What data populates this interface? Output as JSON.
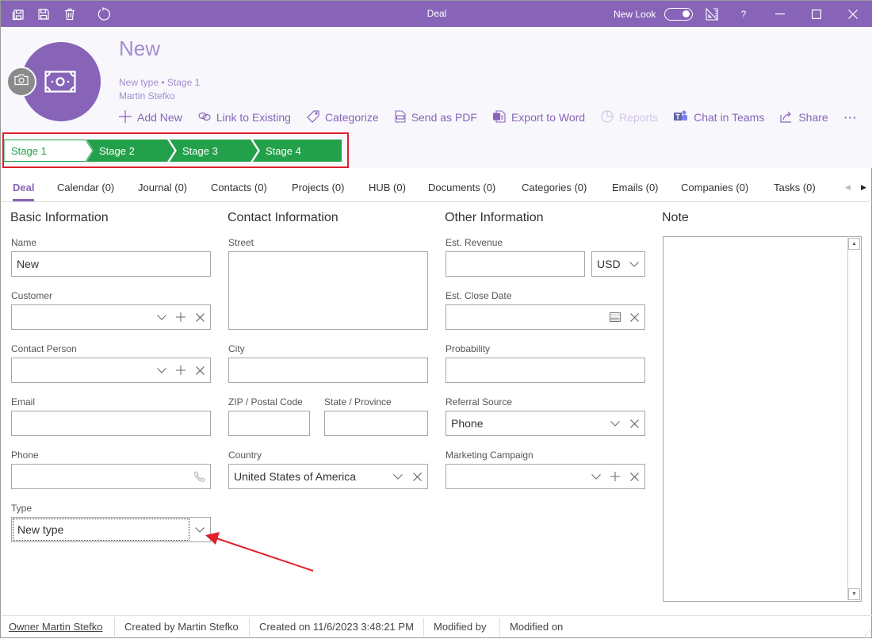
{
  "window": {
    "title": "Deal",
    "new_look_label": "New Look",
    "new_look_on": true,
    "help_label": "?"
  },
  "titlebar_icons": [
    "save-and-close-icon",
    "save-icon",
    "delete-icon",
    "refresh-icon"
  ],
  "record": {
    "title": "New",
    "subtitle": "New type • Stage 1",
    "owner": "Martin Stefko"
  },
  "actions": [
    {
      "label": "Add New",
      "icon": "plus-icon",
      "enabled": true
    },
    {
      "label": "Link to Existing",
      "icon": "link-icon",
      "enabled": true
    },
    {
      "label": "Categorize",
      "icon": "tag-icon",
      "enabled": true
    },
    {
      "label": "Send as PDF",
      "icon": "pdf-icon",
      "enabled": true
    },
    {
      "label": "Export to Word",
      "icon": "word-icon",
      "enabled": true
    },
    {
      "label": "Reports",
      "icon": "pie-chart-icon",
      "enabled": false
    },
    {
      "label": "Chat in Teams",
      "icon": "teams-icon",
      "enabled": true
    },
    {
      "label": "Share",
      "icon": "share-icon",
      "enabled": true
    }
  ],
  "stages": [
    {
      "label": "Stage 1",
      "current": true
    },
    {
      "label": "Stage 2",
      "current": false
    },
    {
      "label": "Stage 3",
      "current": false
    },
    {
      "label": "Stage 4",
      "current": false
    }
  ],
  "colors": {
    "brand": "#8764b8",
    "stage_green": "#23a04a",
    "highlight_red": "#e0202a"
  },
  "tabs": [
    {
      "label": "Deal",
      "active": true
    },
    {
      "label": "Calendar (0)"
    },
    {
      "label": "Journal (0)"
    },
    {
      "label": "Contacts (0)"
    },
    {
      "label": "Projects (0)"
    },
    {
      "label": "HUB (0)"
    },
    {
      "label": "Documents (0)"
    },
    {
      "label": "Categories (0)"
    },
    {
      "label": "Emails (0)"
    },
    {
      "label": "Companies (0)"
    },
    {
      "label": "Tasks (0)"
    }
  ],
  "sections": {
    "basic": {
      "title": "Basic Information",
      "name_label": "Name",
      "name_value": "New",
      "customer_label": "Customer",
      "customer_value": "",
      "contact_person_label": "Contact Person",
      "contact_person_value": "",
      "email_label": "Email",
      "email_value": "",
      "phone_label": "Phone",
      "phone_value": "",
      "type_label": "Type",
      "type_value": "New type"
    },
    "contact": {
      "title": "Contact Information",
      "street_label": "Street",
      "street_value": "",
      "city_label": "City",
      "city_value": "",
      "zip_label": "ZIP / Postal Code",
      "zip_value": "",
      "state_label": "State / Province",
      "state_value": "",
      "country_label": "Country",
      "country_value": "United States of America"
    },
    "other": {
      "title": "Other Information",
      "revenue_label": "Est. Revenue",
      "revenue_value": "",
      "currency_value": "USD",
      "close_date_label": "Est. Close Date",
      "close_date_value": "",
      "probability_label": "Probability",
      "probability_value": "",
      "referral_label": "Referral Source",
      "referral_value": "Phone",
      "campaign_label": "Marketing Campaign",
      "campaign_value": ""
    },
    "note": {
      "title": "Note",
      "value": ""
    }
  },
  "footer": {
    "owner": "Owner Martin Stefko",
    "created_by": "Created by Martin Stefko",
    "created_on": "Created on 11/6/2023 3:48:21 PM",
    "modified_by": "Modified by",
    "modified_on": "Modified on"
  }
}
